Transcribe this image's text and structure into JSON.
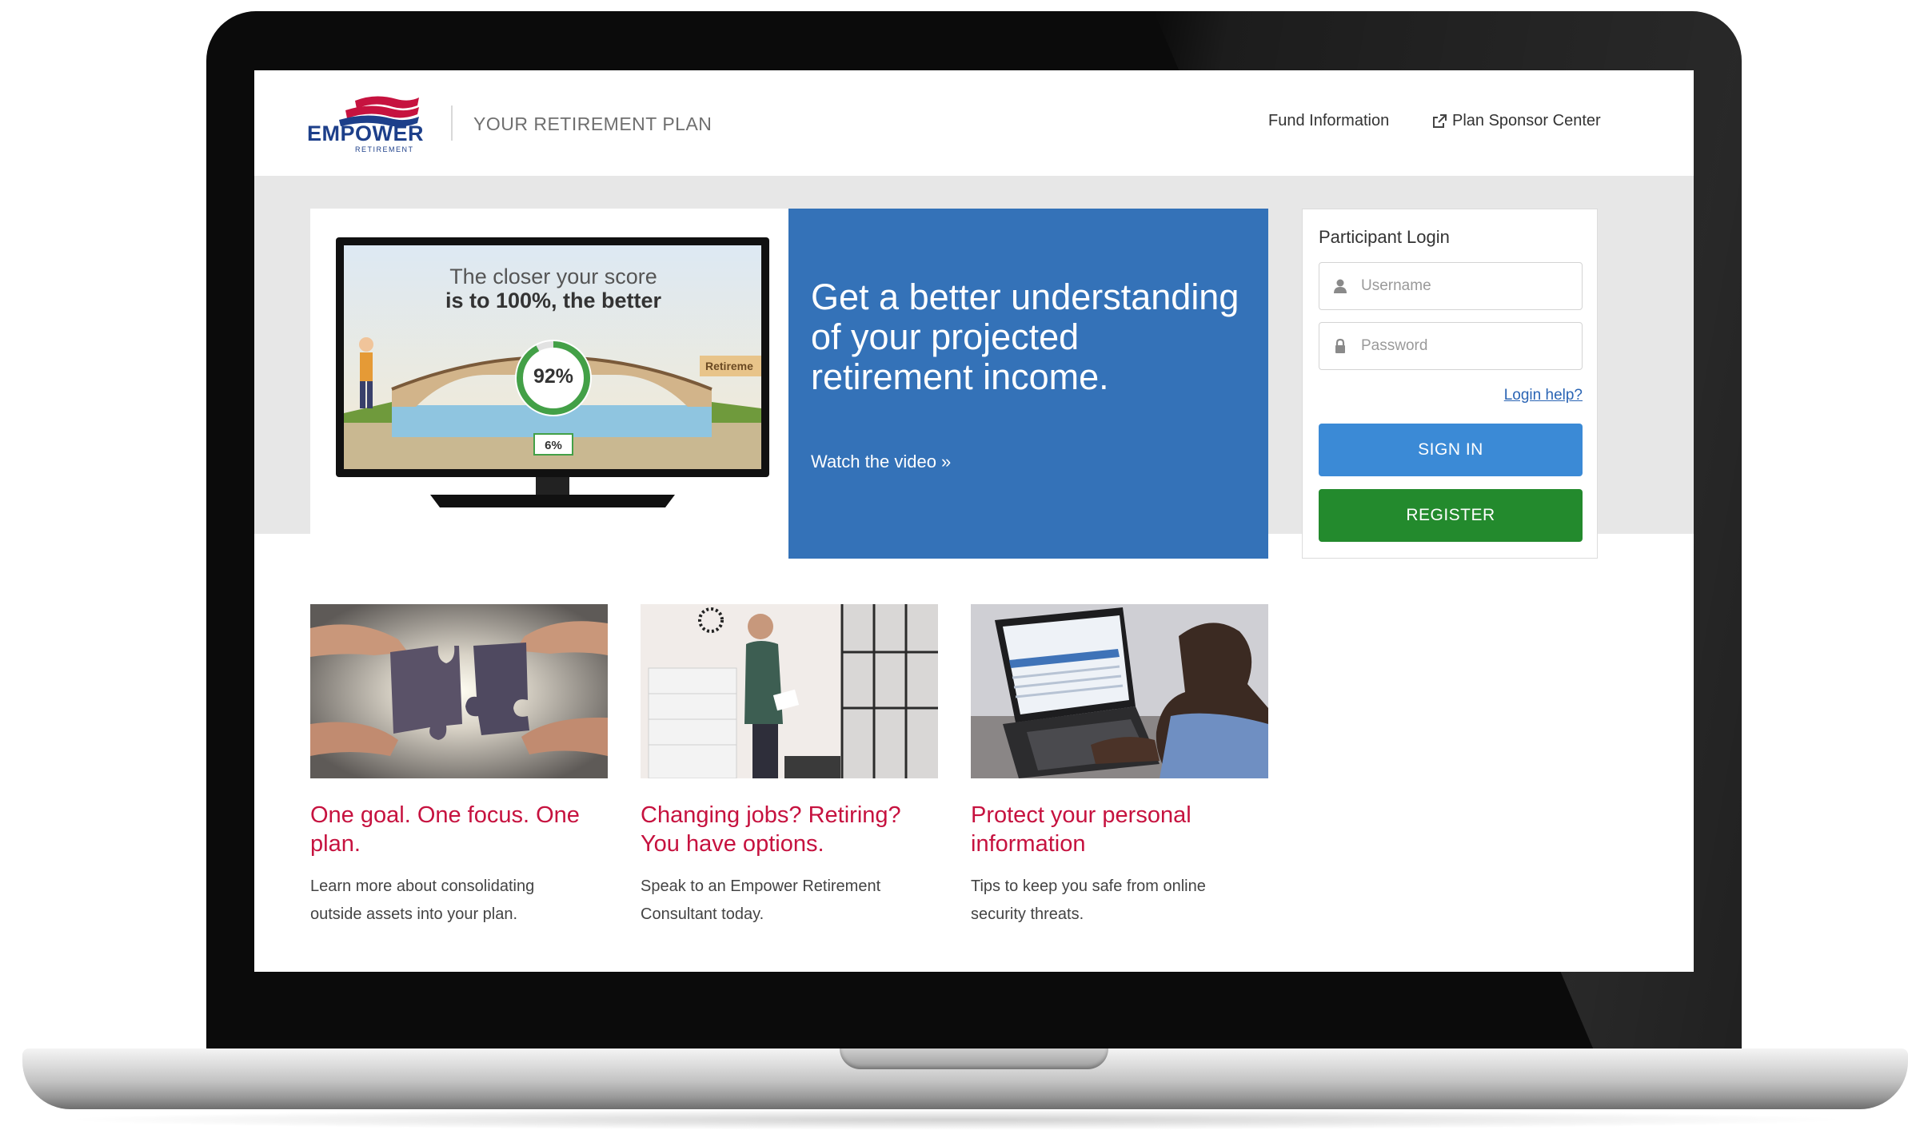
{
  "header": {
    "logo_text": "EMPOWER",
    "logo_subtext": "RETIREMENT",
    "plan_title": "YOUR RETIREMENT PLAN",
    "nav": {
      "fund_information": "Fund Information",
      "plan_sponsor_center": "Plan Sponsor Center"
    }
  },
  "hero": {
    "video": {
      "line1": "The closer your score",
      "line2": "is to 100%, the better",
      "score": "92%",
      "savings": "6%",
      "sign": "Retireme"
    },
    "title": "Get a better understanding of your projected retirement income.",
    "link": "Watch the video »",
    "color": "#3472b8"
  },
  "login": {
    "title": "Participant Login",
    "username_placeholder": "Username",
    "password_placeholder": "Password",
    "help_link": "Login help?",
    "sign_in_label": "SIGN IN",
    "register_label": "REGISTER",
    "sign_in_color": "#3b8ad6",
    "register_color": "#238a2d"
  },
  "cards": [
    {
      "title": "One goal. One focus. One plan.",
      "text": "Learn more about consolidating outside assets into your plan."
    },
    {
      "title": "Changing jobs? Retiring? You have options.",
      "text": "Speak to an Empower Retirement Consultant today."
    },
    {
      "title": "Protect your personal information",
      "text": "Tips to keep you safe from online security threats."
    }
  ],
  "accent_color": "#c6123f"
}
